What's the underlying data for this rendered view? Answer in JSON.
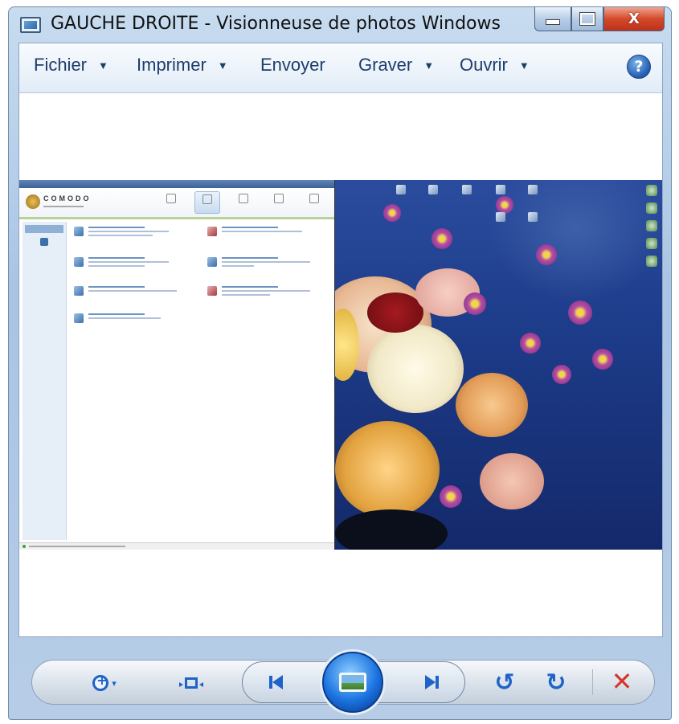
{
  "window": {
    "title": "GAUCHE DROITE - Visionneuse de photos Windows",
    "minimize_glyph": "",
    "close_glyph": "X"
  },
  "menu": {
    "items": [
      {
        "label": "Fichier",
        "has_dropdown": true
      },
      {
        "label": "Imprimer",
        "has_dropdown": true
      },
      {
        "label": "Envoyer",
        "has_dropdown": false
      },
      {
        "label": "Graver",
        "has_dropdown": true
      },
      {
        "label": "Ouvrir",
        "has_dropdown": true
      }
    ],
    "caret": "▼",
    "help_label": "?"
  },
  "photo": {
    "left_app": {
      "brand": "COMODO",
      "icon": "comodo-logo-icon"
    },
    "right_desktop": {
      "icon": "flower-wallpaper"
    }
  },
  "controls": {
    "zoom_caret": "▾",
    "rotate_ccw_glyph": "↺",
    "rotate_cw_glyph": "↻",
    "delete_glyph": "✕",
    "colors": {
      "accent": "#1f63c8",
      "delete": "#d8352a"
    }
  }
}
